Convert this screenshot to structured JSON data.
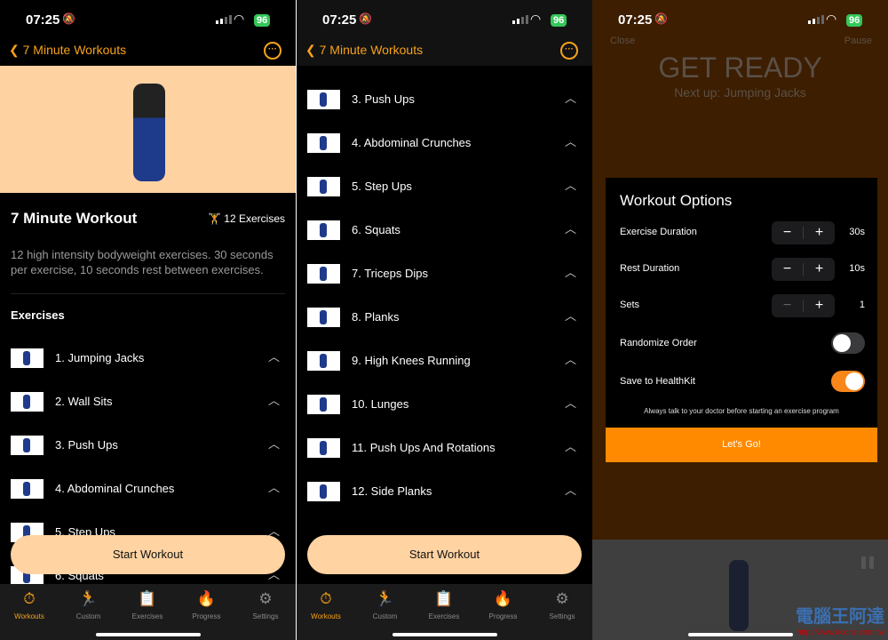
{
  "status": {
    "time": "07:25",
    "battery": "96"
  },
  "nav": {
    "back_label": "7 Minute Workouts"
  },
  "workout": {
    "title": "7 Minute Workout",
    "count": "12 Exercises",
    "description": "12 high intensity bodyweight exercises. 30 seconds per exercise, 10 seconds rest between exercises.",
    "section": "Exercises"
  },
  "exercises": [
    "1. Jumping Jacks",
    "2. Wall Sits",
    "3. Push Ups",
    "4. Abdominal Crunches",
    "5. Step Ups",
    "6. Squats",
    "7. Triceps Dips",
    "8. Planks",
    "9. High Knees Running",
    "10. Lunges",
    "11. Push Ups And Rotations",
    "12. Side Planks"
  ],
  "start_label": "Start Workout",
  "tabs": [
    {
      "label": "Workouts",
      "icon": "stopwatch-icon",
      "active": true
    },
    {
      "label": "Custom",
      "icon": "runner-icon"
    },
    {
      "label": "Exercises",
      "icon": "clipboard-icon"
    },
    {
      "label": "Progress",
      "icon": "flame-icon"
    },
    {
      "label": "Settings",
      "icon": "gear-icon"
    }
  ],
  "session": {
    "close": "Close",
    "pause": "Pause",
    "heading": "GET READY",
    "next_up": "Next up: Jumping Jacks"
  },
  "options": {
    "title": "Workout Options",
    "exercise_duration": {
      "label": "Exercise Duration",
      "value": "30s"
    },
    "rest_duration": {
      "label": "Rest Duration",
      "value": "10s"
    },
    "sets": {
      "label": "Sets",
      "value": "1"
    },
    "randomize": {
      "label": "Randomize Order",
      "on": false
    },
    "healthkit": {
      "label": "Save to HealthKit",
      "on": true
    },
    "note": "Always talk to your doctor before starting an exercise program",
    "go_label": "Let's Go!"
  },
  "watermark": {
    "text": "電腦王阿達",
    "url": "http://www.kocpc.com.tw"
  },
  "colors": {
    "accent": "#f7a21b",
    "peach": "#ffd2a2",
    "go": "#ff8a00"
  }
}
